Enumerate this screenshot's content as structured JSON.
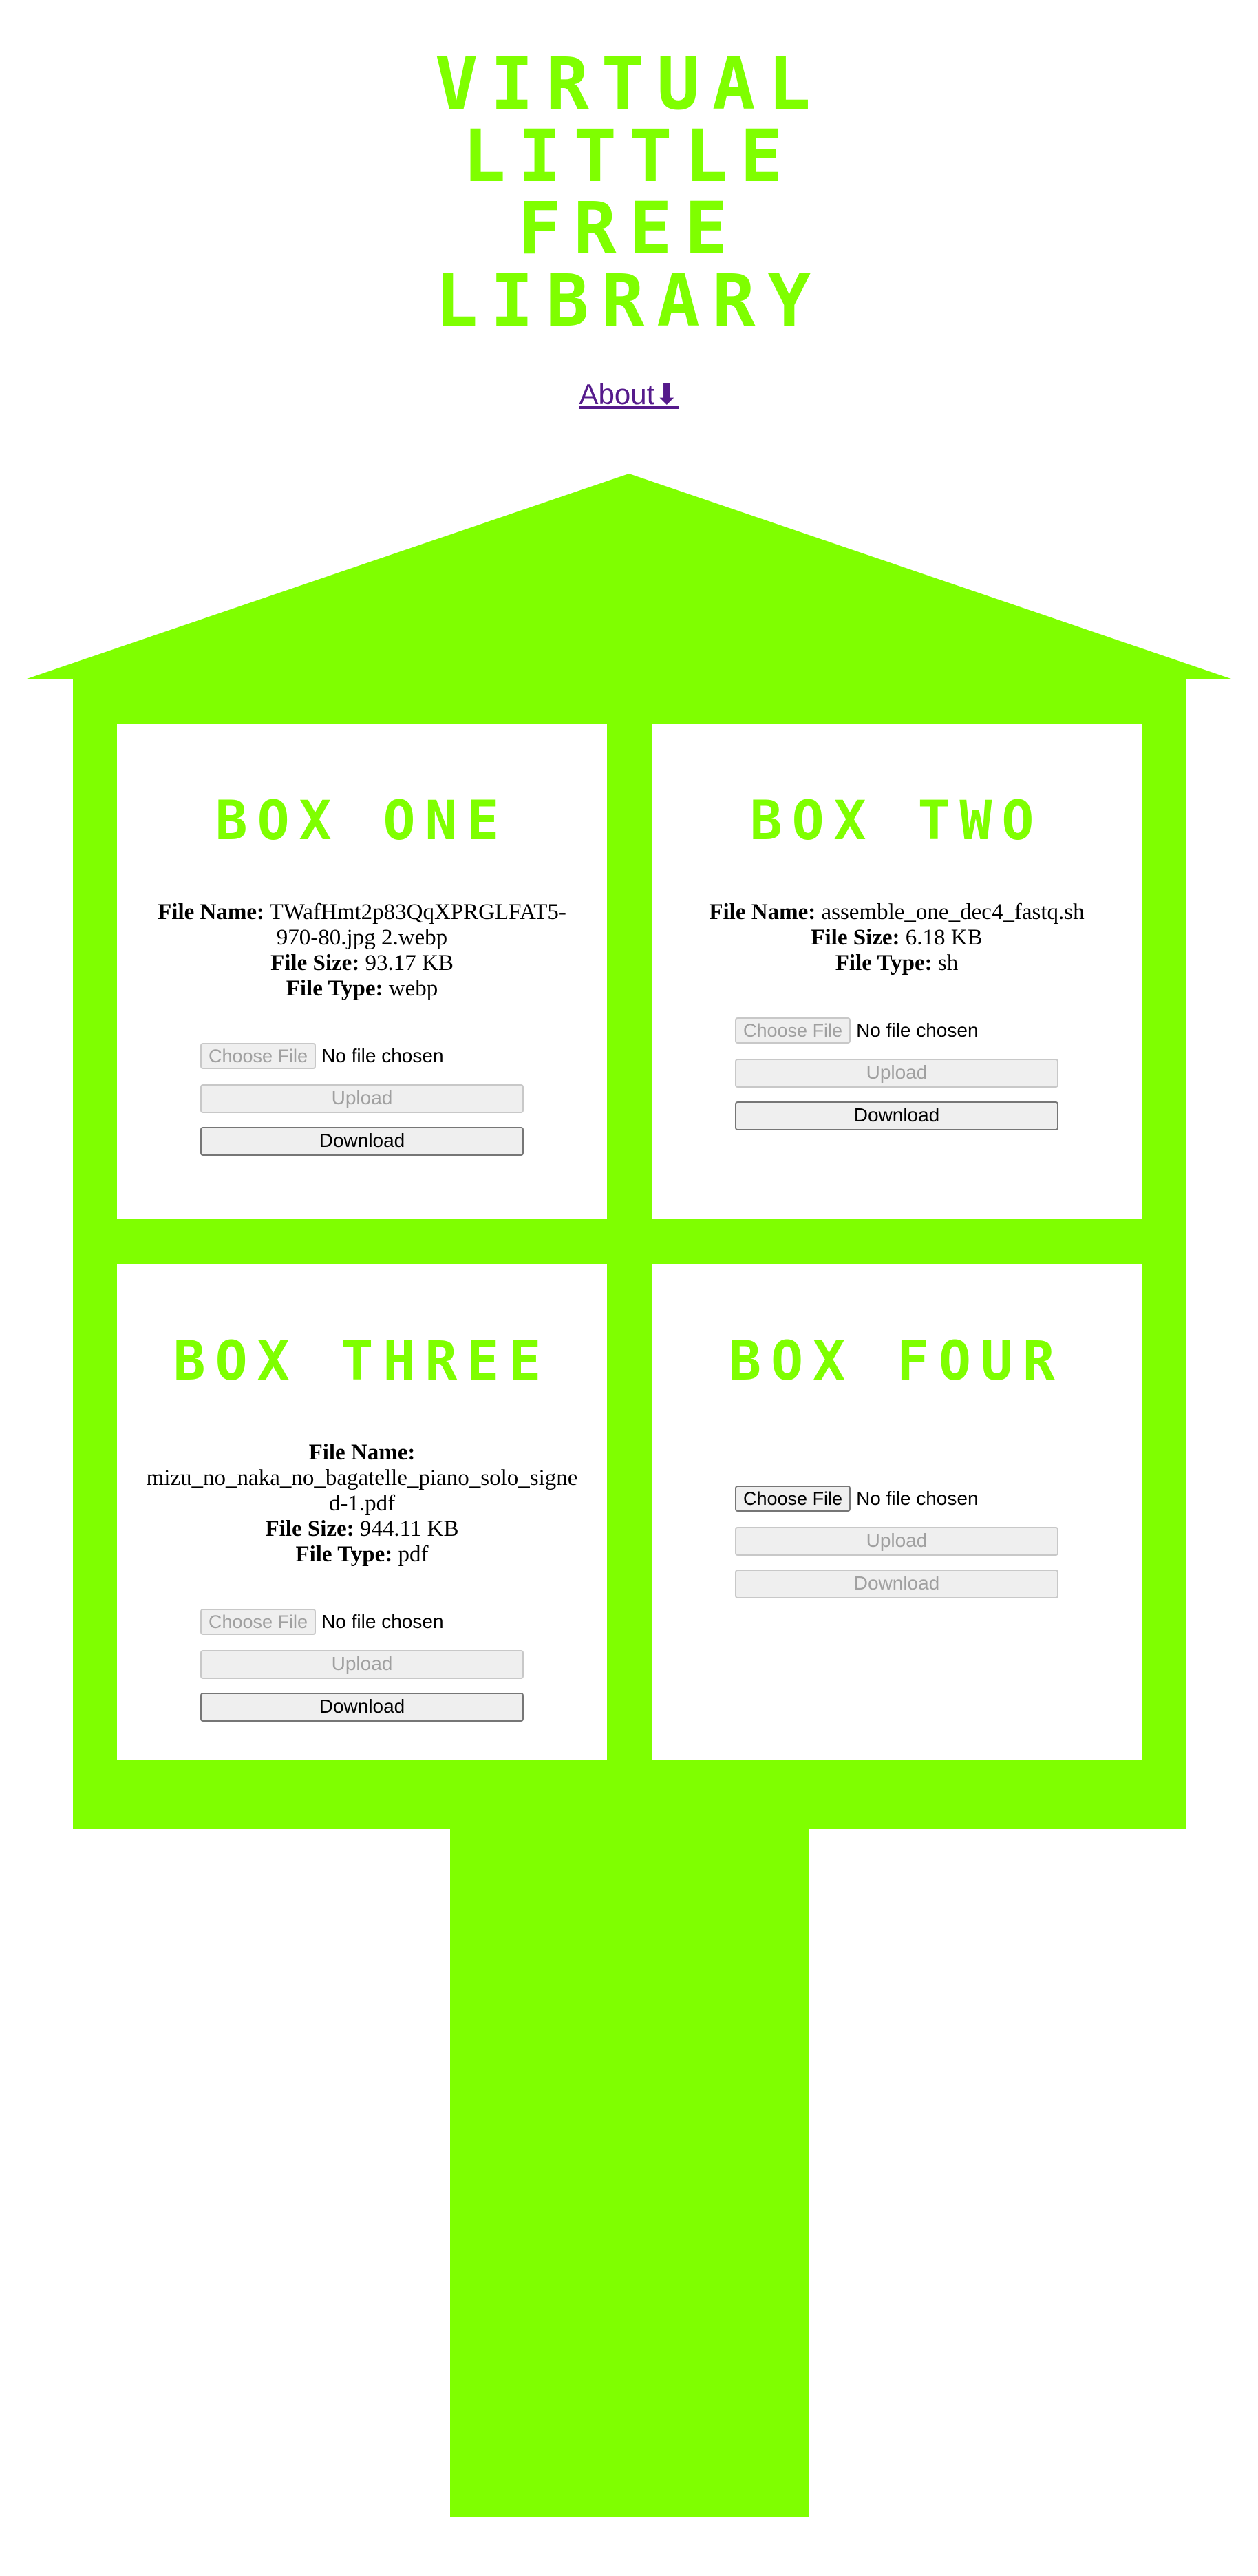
{
  "header": {
    "title_lines": [
      "Virtual",
      "Little",
      "Free",
      "Library"
    ],
    "about_link": "About⬇"
  },
  "colors": {
    "accent": "#7fff00",
    "link": "#551a8b"
  },
  "labels": {
    "file_name": "File Name:",
    "file_size": "File Size:",
    "file_type": "File Type:"
  },
  "boxes": [
    {
      "title": "Box One",
      "file_name": "TWafHmt2p83QqXPRGLFAT5-970-80.jpg 2.webp",
      "file_size": "93.17 KB",
      "file_type": "webp",
      "choose_label": "Choose File",
      "no_file": "No file chosen",
      "upload_label": "Upload",
      "download_label": "Download"
    },
    {
      "title": "Box Two",
      "file_name": "assemble_one_dec4_fastq.sh",
      "file_size": "6.18 KB",
      "file_type": "sh",
      "choose_label": "Choose File",
      "no_file": "No file chosen",
      "upload_label": "Upload",
      "download_label": "Download"
    },
    {
      "title": "Box Three",
      "file_name": "mizu_no_naka_no_bagatelle_piano_solo_signed-1.pdf",
      "file_size": "944.11 KB",
      "file_type": "pdf",
      "choose_label": "Choose File",
      "no_file": "No file chosen",
      "upload_label": "Upload",
      "download_label": "Download"
    },
    {
      "title": "Box Four",
      "choose_label": "Choose File",
      "no_file": "No file chosen",
      "upload_label": "Upload",
      "download_label": "Download"
    }
  ]
}
